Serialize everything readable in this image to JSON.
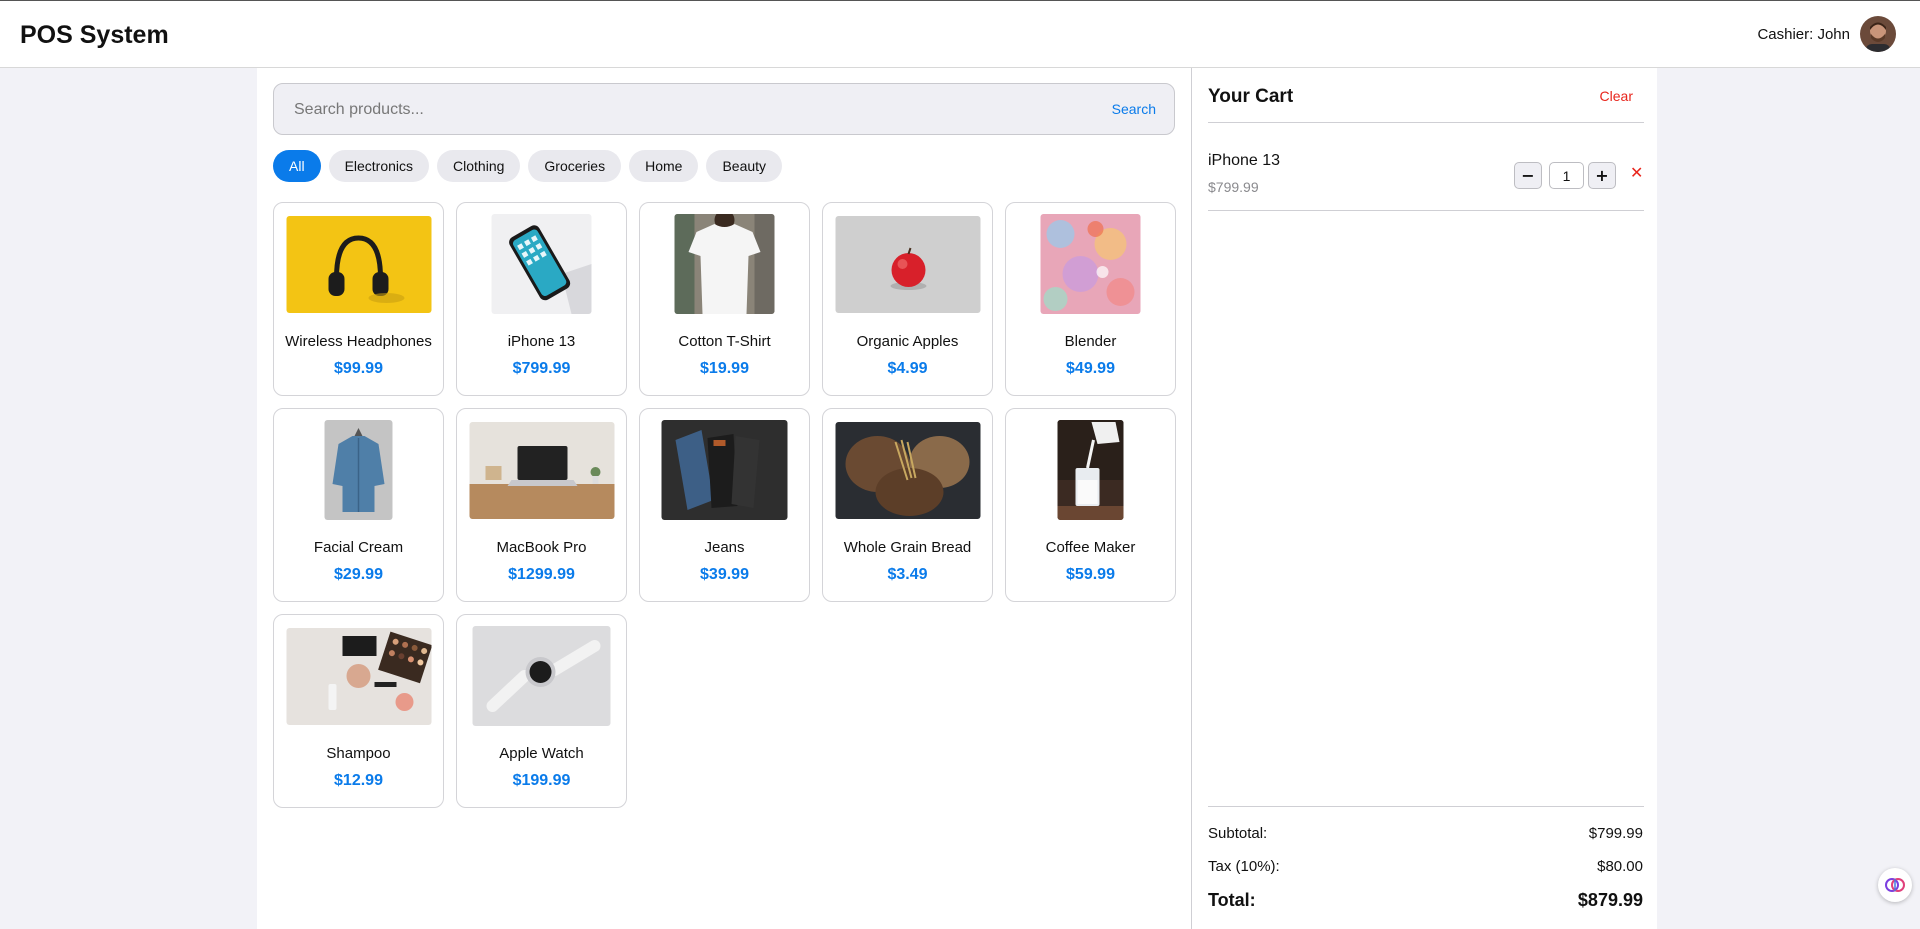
{
  "header": {
    "title": "POS System",
    "cashier": "Cashier: John"
  },
  "search": {
    "placeholder": "Search products...",
    "value": "",
    "button_label": "Search"
  },
  "categories": [
    {
      "label": "All",
      "active": true
    },
    {
      "label": "Electronics",
      "active": false
    },
    {
      "label": "Clothing",
      "active": false
    },
    {
      "label": "Groceries",
      "active": false
    },
    {
      "label": "Home",
      "active": false
    },
    {
      "label": "Beauty",
      "active": false
    }
  ],
  "products": [
    {
      "name": "Wireless Headphones",
      "price": "$99.99",
      "image": "headphones-photo"
    },
    {
      "name": "iPhone 13",
      "price": "$799.99",
      "image": "phone-photo"
    },
    {
      "name": "Cotton T-Shirt",
      "price": "$19.99",
      "image": "tshirt-photo"
    },
    {
      "name": "Organic Apples",
      "price": "$4.99",
      "image": "apple-photo"
    },
    {
      "name": "Blender",
      "price": "$49.99",
      "image": "abstract-art-photo"
    },
    {
      "name": "Facial Cream",
      "price": "$29.99",
      "image": "denim-shirt-photo"
    },
    {
      "name": "MacBook Pro",
      "price": "$1299.99",
      "image": "laptop-photo"
    },
    {
      "name": "Jeans",
      "price": "$39.99",
      "image": "jeans-photo"
    },
    {
      "name": "Whole Grain Bread",
      "price": "$3.49",
      "image": "bread-photo"
    },
    {
      "name": "Coffee Maker",
      "price": "$59.99",
      "image": "milk-pour-photo"
    },
    {
      "name": "Shampoo",
      "price": "$12.99",
      "image": "makeup-photo"
    },
    {
      "name": "Apple Watch",
      "price": "$199.99",
      "image": "watch-photo"
    }
  ],
  "cart": {
    "title": "Your Cart",
    "clear_label": "Clear",
    "items": [
      {
        "name": "iPhone 13",
        "price": "$799.99",
        "quantity": "1"
      }
    ],
    "decrement_symbol": "−",
    "increment_symbol": "+",
    "remove_symbol": "✕",
    "subtotal_label": "Subtotal:",
    "subtotal": "$799.99",
    "tax_label": "Tax (10%):",
    "tax": "$80.00",
    "total_label": "Total:",
    "total": "$879.99"
  },
  "colors": {
    "accent": "#0a7bea",
    "danger": "#e8251c",
    "background": "#f2f2f7"
  }
}
